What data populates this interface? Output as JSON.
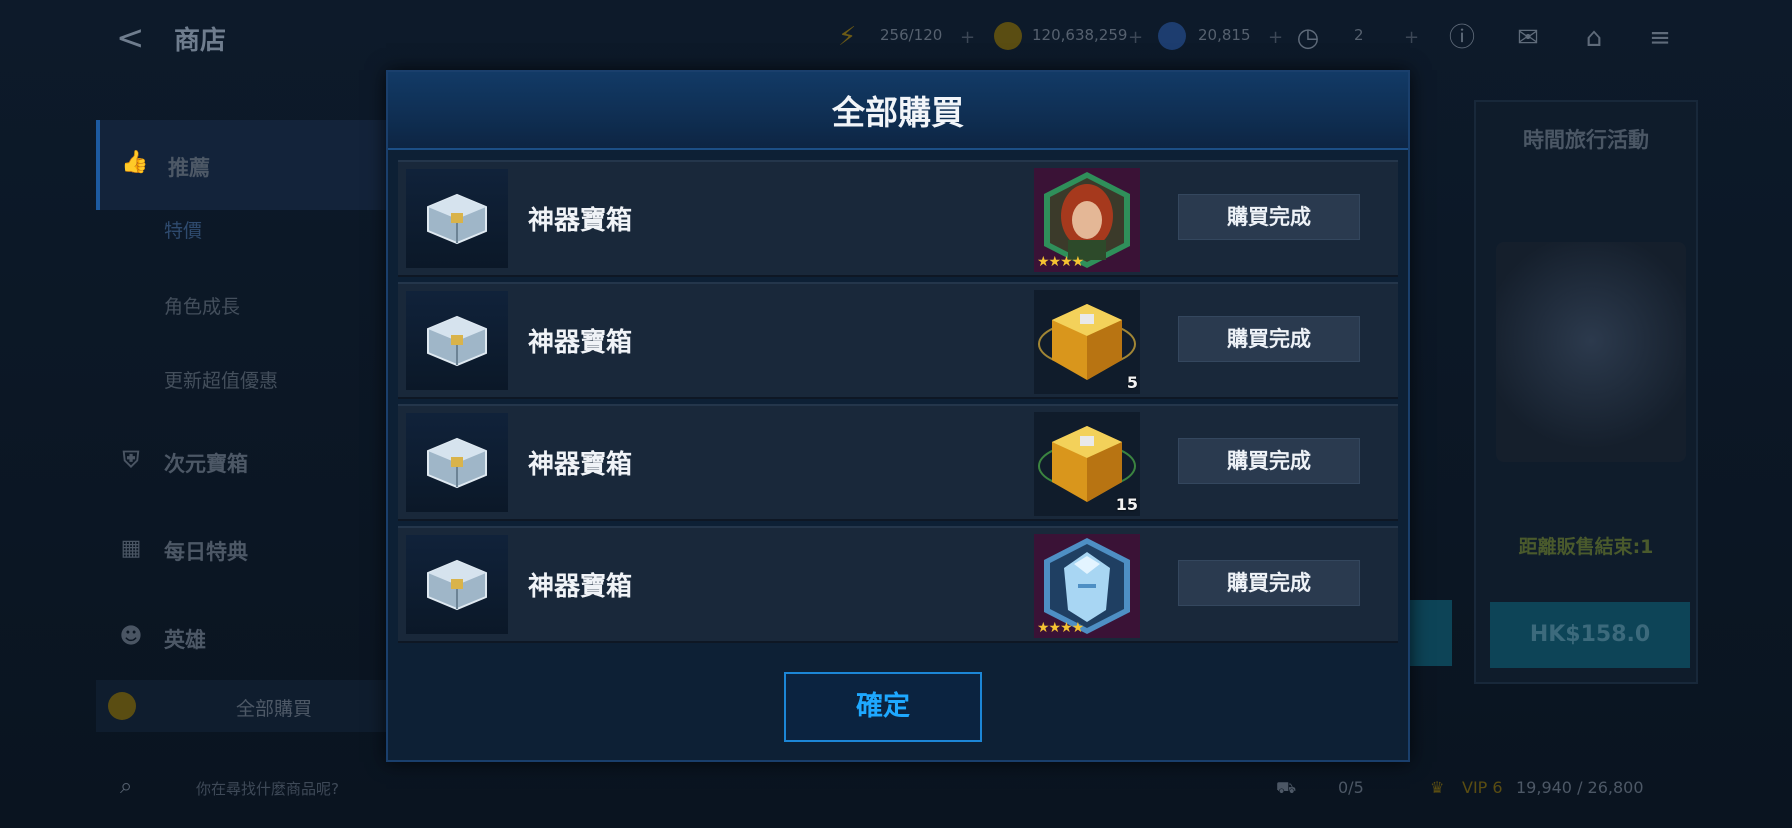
{
  "topbar": {
    "title": "商店",
    "energy": "256/120",
    "gold": "120,638,259",
    "crystals": "20,815",
    "timer": "2"
  },
  "sidebar": {
    "items": [
      {
        "label": "推薦"
      },
      {
        "label": "特價"
      },
      {
        "label": "角色成長"
      },
      {
        "label": "更新超值優惠"
      },
      {
        "label": "次元寶箱"
      },
      {
        "label": "每日特典"
      },
      {
        "label": "英雄"
      },
      {
        "label": "全部購買"
      }
    ],
    "search_placeholder": "你在尋找什麼商品呢?"
  },
  "right_card": {
    "title": "時間旅行活動",
    "timer": "距離販售結束:1",
    "price": "HK$158.0"
  },
  "bottom": {
    "limit": "0/5",
    "vip": "VIP 6",
    "vip_progress": "19,940 / 26,800"
  },
  "modal": {
    "title": "全部購買",
    "items": [
      {
        "name": "神器寶箱",
        "reward": "character-portrait-red-hair",
        "count": "",
        "stars": "★★★★",
        "status": "購買完成"
      },
      {
        "name": "神器寶箱",
        "reward": "gold-cube",
        "count": "5",
        "stars": "",
        "status": "購買完成"
      },
      {
        "name": "神器寶箱",
        "reward": "gold-cube",
        "count": "15",
        "stars": "",
        "status": "購買完成"
      },
      {
        "name": "神器寶箱",
        "reward": "character-portrait-ice",
        "count": "",
        "stars": "★★★★",
        "status": "購買完成"
      }
    ],
    "confirm_label": "確定"
  }
}
